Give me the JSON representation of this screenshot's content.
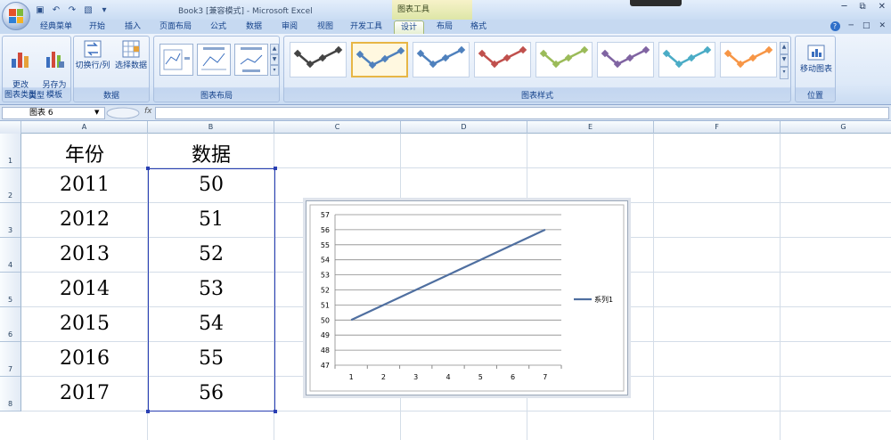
{
  "window": {
    "title": "Book3  [兼容模式] - Microsoft Excel",
    "tool_context": "图表工具"
  },
  "tabs": [
    {
      "label": "经典菜单",
      "active": false
    },
    {
      "label": "开始",
      "active": false
    },
    {
      "label": "插入",
      "active": false
    },
    {
      "label": "页面布局",
      "active": false
    },
    {
      "label": "公式",
      "active": false
    },
    {
      "label": "数据",
      "active": false
    },
    {
      "label": "审阅",
      "active": false
    },
    {
      "label": "视图",
      "active": false
    },
    {
      "label": "开发工具",
      "active": false
    },
    {
      "label": "设计",
      "active": true
    },
    {
      "label": "布局",
      "active": false
    },
    {
      "label": "格式",
      "active": false
    }
  ],
  "ribbon": {
    "type_group": {
      "label": "类型",
      "change_chart_type": "更改\n图表类型",
      "save_as_template": "另存为\n模板"
    },
    "data_group": {
      "label": "数据",
      "switch_row_col": "切换行/列",
      "select_data": "选择数据"
    },
    "layout_group": {
      "label": "图表布局"
    },
    "style_group": {
      "label": "图表样式",
      "styles": [
        "#444444",
        "#4f81bd",
        "#4f81bd",
        "#c0504d",
        "#9bbb59",
        "#8064a2",
        "#4bacc6",
        "#f79646"
      ],
      "selected_index": 1
    },
    "location_group": {
      "label": "位置",
      "move_chart": "移动图表"
    }
  },
  "formula_bar": {
    "name_box": "图表 6",
    "fx": "fx",
    "value": ""
  },
  "sheet": {
    "columns": [
      "A",
      "B",
      "C",
      "D",
      "E",
      "F",
      "G"
    ],
    "rows": [
      "1",
      "2",
      "3",
      "4",
      "5",
      "6",
      "7",
      "8"
    ],
    "header_year": "年份",
    "header_data": "数据",
    "years": [
      "2011",
      "2012",
      "2013",
      "2014",
      "2015",
      "2016",
      "2017"
    ],
    "values": [
      "50",
      "51",
      "52",
      "53",
      "54",
      "55",
      "56"
    ]
  },
  "chart_data": {
    "type": "line",
    "categories": [
      "1",
      "2",
      "3",
      "4",
      "5",
      "6",
      "7"
    ],
    "series": [
      {
        "name": "系列1",
        "values": [
          50,
          51,
          52,
          53,
          54,
          55,
          56
        ],
        "color": "#4f6fa0"
      }
    ],
    "ylim": [
      47,
      57
    ],
    "yticks": [
      "47",
      "48",
      "49",
      "50",
      "51",
      "52",
      "53",
      "54",
      "55",
      "56",
      "57"
    ],
    "grid": true,
    "legend": "right",
    "title": "",
    "xlabel": "",
    "ylabel": ""
  }
}
